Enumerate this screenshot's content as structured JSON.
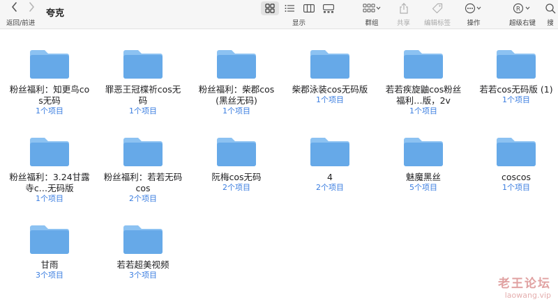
{
  "toolbar": {
    "nav_label": "返回/前进",
    "title": "夸克",
    "view_label": "显示",
    "group_label": "群组",
    "share_label": "共享",
    "edit_tags_label": "编辑标签",
    "actions_label": "操作",
    "advanced_right_click_label": "超级右键",
    "search_label": "搜"
  },
  "folders": [
    {
      "name": "粉丝福利：知更鸟cos无码",
      "count": "1个项目"
    },
    {
      "name": "罪恶王冠楪祈cos无码",
      "count": "1个项目"
    },
    {
      "name": "粉丝福利：柴郡cos (黑丝无码)",
      "count": "1个项目"
    },
    {
      "name": "柴郡泳装cos无码版",
      "count": "1个项目"
    },
    {
      "name": "若若疾旋鼬cos粉丝福利…版，2v",
      "count": "1个项目"
    },
    {
      "name": "若若cos无码版 (1)",
      "count": "1个项目"
    },
    {
      "name": "粉丝福利：3.24甘露寺c…无码版",
      "count": "1个项目"
    },
    {
      "name": "粉丝福利：若若无码cos",
      "count": "2个项目"
    },
    {
      "name": "阮梅cos无码",
      "count": "2个项目"
    },
    {
      "name": "4",
      "count": "2个项目"
    },
    {
      "name": "魅魔黑丝",
      "count": "5个项目"
    },
    {
      "name": "coscos",
      "count": "1个项目"
    },
    {
      "name": "甘雨",
      "count": "3个项目"
    },
    {
      "name": "若若超美视频",
      "count": "3个项目"
    }
  ],
  "watermark": {
    "title": "老王论坛",
    "url": "laowang.vip"
  },
  "colors": {
    "folder_body": "#66a9e8",
    "folder_tab": "#8cc2f2",
    "count_text": "#3a7de0"
  }
}
